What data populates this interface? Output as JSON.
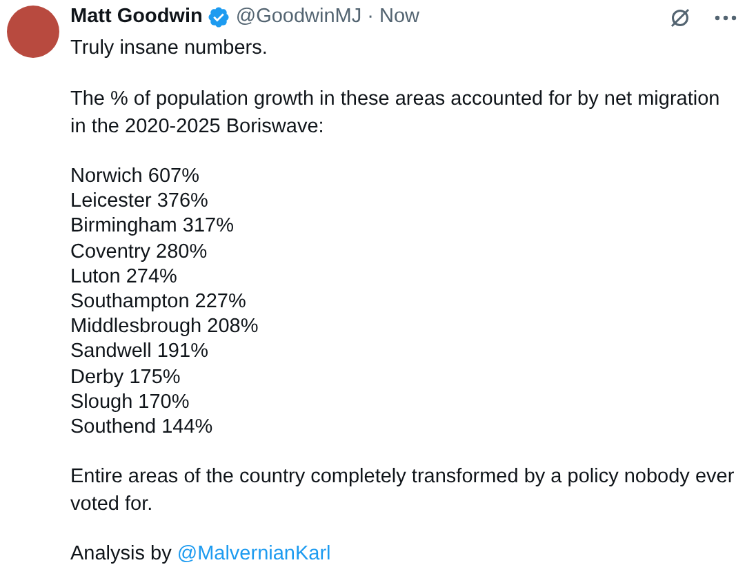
{
  "author": {
    "name": "Matt Goodwin",
    "verified": true,
    "handle": "@GoodwinMJ",
    "separator": "·",
    "time": "Now"
  },
  "tweet": {
    "lead": "Truly insane numbers.",
    "intro": "The % of population growth in these areas accounted for by net migration in the 2020-2025 Boriswave:",
    "items": [
      "Norwich 607%",
      "Leicester 376%",
      "Birmingham 317%",
      "Coventry 280%",
      "Luton 274%",
      "Southampton 227%",
      "Middlesbrough 208%",
      "Sandwell 191%",
      "Derby 175%",
      "Slough 170%",
      "Southend 144%"
    ],
    "closing": "Entire areas of the country completely transformed by a policy nobody ever voted for.",
    "credit": {
      "text": "Analysis by",
      "link": "@MalvernianKarl"
    }
  }
}
